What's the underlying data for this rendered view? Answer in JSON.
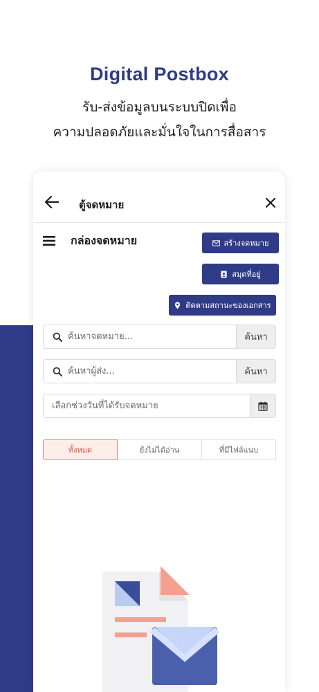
{
  "hero": {
    "title": "Digital Postbox",
    "subtitle_line1": "รับ-ส่งข้อมูลบนระบบปิดเพื่อ",
    "subtitle_line2": "ความปลอดภัยและมั่นใจในการสื่อสาร"
  },
  "topbar": {
    "title": "ตู้จดหมาย",
    "back_icon": "arrow-left",
    "close_icon": "close"
  },
  "page": {
    "title": "กล่องจดหมาย",
    "menu_icon": "hamburger"
  },
  "actions": {
    "compose_label": "สร้างจดหมาย",
    "address_book_label": "สมุดที่อยู่",
    "track_label": "ติดตามสถานะของเอกสาร"
  },
  "search_mail": {
    "placeholder": "ค้นหาจดหมาย...",
    "button_label": "ค้นหา"
  },
  "search_sender": {
    "placeholder": "ค้นหาผู้ส่ง...",
    "button_label": "ค้นหา"
  },
  "date_filter": {
    "placeholder": "เลือกช่วงวันที่ได้รับจดหมาย"
  },
  "tabs": [
    {
      "label": "ทั้งหมด",
      "active": true
    },
    {
      "label": "ยังไม่ได้อ่าน",
      "active": false
    },
    {
      "label": "ที่มีไฟล์แนบ",
      "active": false
    }
  ],
  "colors": {
    "brand": "#2f3b87",
    "accent": "#ef8d78"
  }
}
